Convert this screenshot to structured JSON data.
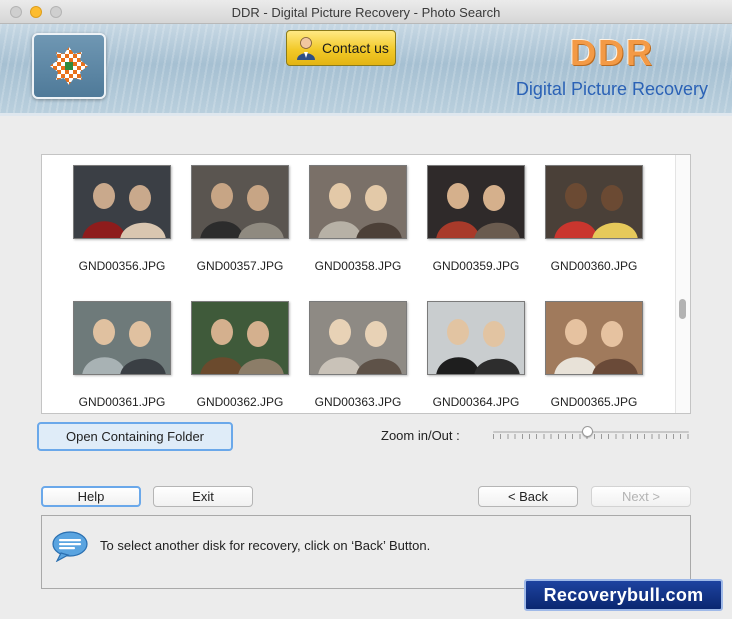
{
  "window": {
    "title": "DDR - Digital Picture Recovery - Photo Search"
  },
  "header": {
    "contact_label": "Contact us",
    "brand_name": "DDR",
    "brand_subtitle": "Digital Picture Recovery"
  },
  "gallery": {
    "items": [
      {
        "filename": "GND00356.JPG"
      },
      {
        "filename": "GND00357.JPG"
      },
      {
        "filename": "GND00358.JPG"
      },
      {
        "filename": "GND00359.JPG"
      },
      {
        "filename": "GND00360.JPG"
      },
      {
        "filename": "GND00361.JPG"
      },
      {
        "filename": "GND00362.JPG"
      },
      {
        "filename": "GND00363.JPG"
      },
      {
        "filename": "GND00364.JPG"
      },
      {
        "filename": "GND00365.JPG"
      }
    ]
  },
  "controls": {
    "open_folder_label": "Open Containing Folder",
    "zoom_label": "Zoom in/Out :",
    "zoom_level": 0.48
  },
  "footer": {
    "help_label": "Help",
    "exit_label": "Exit",
    "back_label": "< Back",
    "next_label": "Next >"
  },
  "status": {
    "message": "To select another disk for recovery, click on ‘Back’ Button."
  },
  "watermark": {
    "text": "Recoverybull.com"
  },
  "colors": {
    "brand_orange": "#f39a46",
    "brand_blue": "#2b62b6",
    "focus_blue": "#6aa8ea",
    "contact_yellow": "#f2c928"
  }
}
